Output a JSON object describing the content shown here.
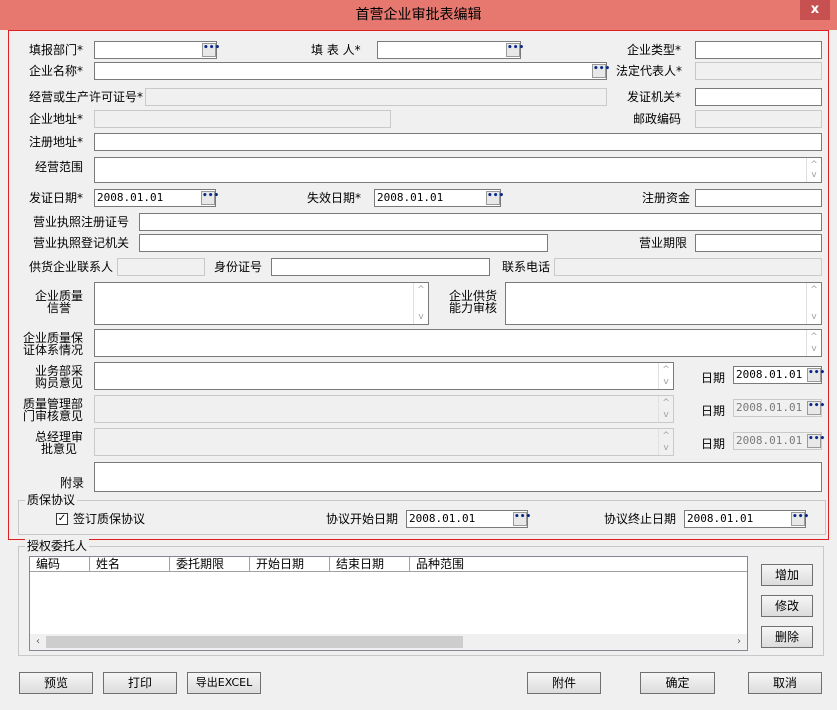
{
  "window": {
    "title": "首营企业审批表编辑",
    "close_label": "x"
  },
  "labels": {
    "dept": "填报部门*",
    "filler": "填 表 人*",
    "company_type": "企业类型*",
    "company_name": "企业名称*",
    "legal_rep": "法定代表人*",
    "license_no": "经营或生产许可证号*",
    "issuer": "发证机关*",
    "company_addr": "企业地址*",
    "postcode": "邮政编码",
    "reg_addr": "注册地址*",
    "business_scope": "经营范围",
    "issue_date": "发证日期*",
    "expiry_date": "失效日期*",
    "reg_capital": "注册资金",
    "biz_license_reg_no": "营业执照注册证号",
    "biz_license_authority": "营业执照登记机关",
    "biz_term": "营业期限",
    "supplier_contact": "供货企业联系人",
    "id_no": "身份证号",
    "phone": "联系电话",
    "quality_credit": "企业质量信誉",
    "supply_capacity": "企业供货能力审核",
    "quality_system": "企业质量保证体系情况",
    "buyer_opinion": "业务部采购员意见",
    "qa_opinion": "质量管理部门审核意见",
    "gm_opinion": "总经理审批意见",
    "date": "日期",
    "appendix": "附录"
  },
  "values": {
    "issue_date": "2008.01.01",
    "expiry_date": "2008.01.01",
    "buyer_date": "2008.01.01",
    "qa_date": "2008.01.01",
    "gm_date": "2008.01.01"
  },
  "icons": {
    "ellipsis": "ellipsis-icon",
    "scroll_up": "scroll-up-icon",
    "scroll_down": "scroll-down-icon"
  },
  "quality_agreement": {
    "group_title": "质保协议",
    "checkbox_label": "签订质保协议",
    "checked": true,
    "check_mark": "✓",
    "start_label": "协议开始日期",
    "start_date": "2008.01.01",
    "end_label": "协议终止日期",
    "end_date": "2008.01.01"
  },
  "delegation": {
    "group_title": "授权委托人",
    "columns": [
      "编码",
      "姓名",
      "委托期限",
      "开始日期",
      "结束日期",
      "品种范围"
    ],
    "buttons": {
      "add": "增加",
      "edit": "修改",
      "delete": "删除"
    },
    "scroll_left": "‹",
    "scroll_right": "›"
  },
  "footer": {
    "preview": "预览",
    "print": "打印",
    "export": "导出EXCEL",
    "attachment": "附件",
    "ok": "确定",
    "cancel": "取消"
  },
  "colors": {
    "titlebar": "#e6786f",
    "highlight_border": "#e02020",
    "close_button": "#c75050"
  }
}
